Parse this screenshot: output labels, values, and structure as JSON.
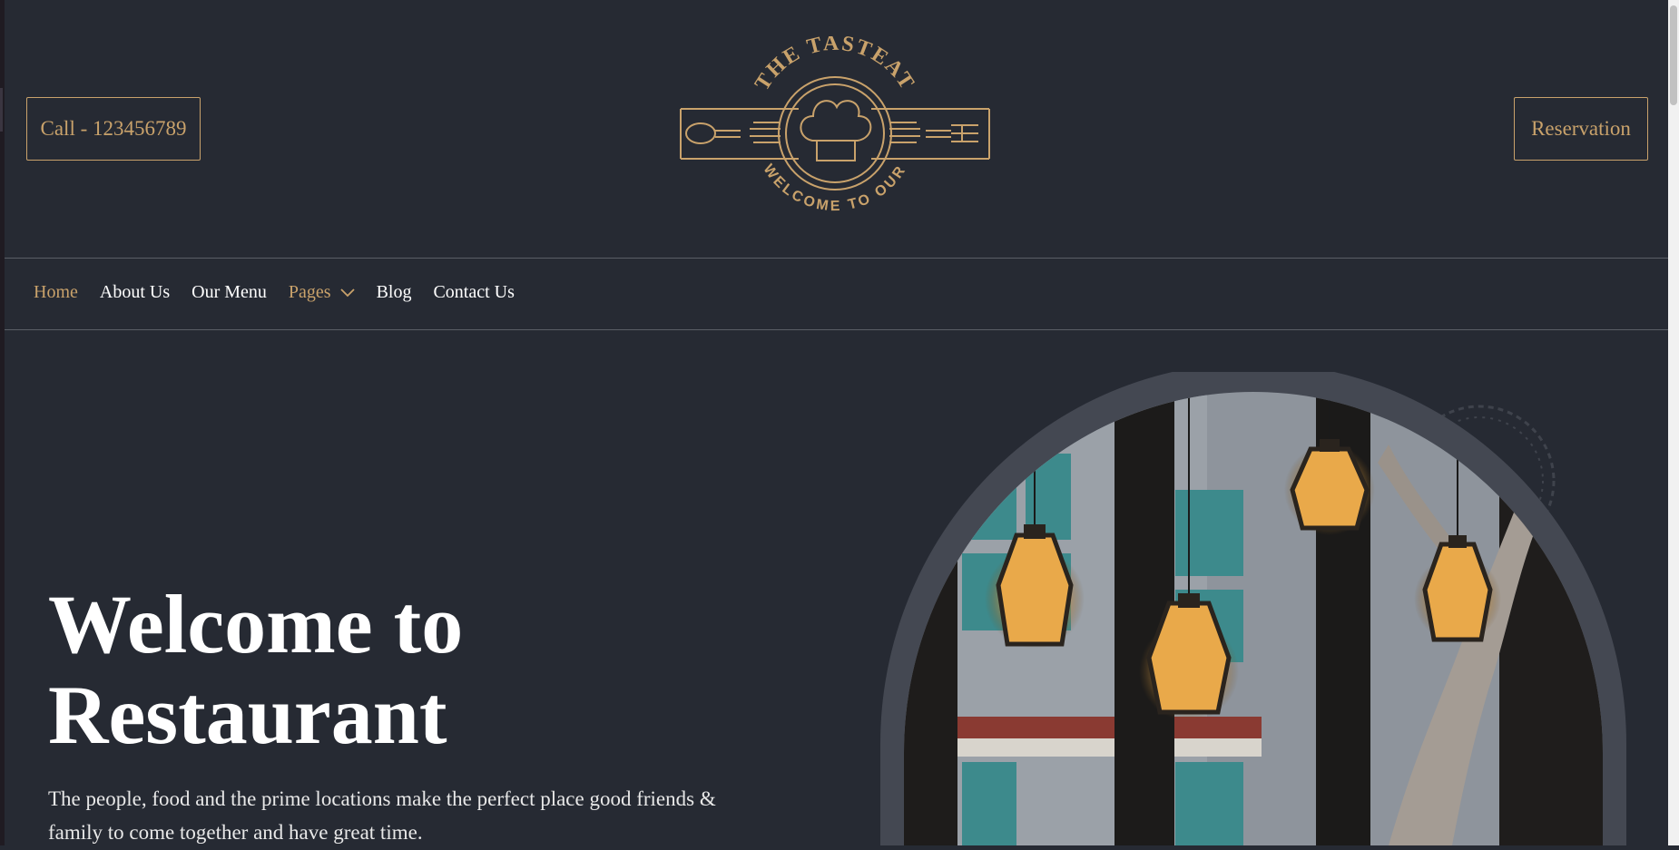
{
  "header": {
    "call_label": "Call - 123456789",
    "reservation_label": "Reservation",
    "logo": {
      "top_text": "THE TASTEAT",
      "bottom_text": "WELCOME TO OUR"
    }
  },
  "nav": {
    "items": [
      {
        "label": "Home"
      },
      {
        "label": "About Us"
      },
      {
        "label": "Our Menu"
      },
      {
        "label": "Pages"
      },
      {
        "label": "Blog"
      },
      {
        "label": "Contact Us"
      }
    ]
  },
  "hero": {
    "title_line1": "Welcome to",
    "title_line2": "Restaurant",
    "description": "The people, food and the prime locations make the perfect place good friends & family to come together and have great time."
  },
  "colors": {
    "background": "#262a33",
    "accent": "#c9a26b",
    "text": "#ffffff"
  },
  "icons": {
    "dropdown": "chevron-down-icon",
    "logo_spoon": "spoon-icon",
    "logo_fork": "fork-icon",
    "logo_chef_hat": "chef-hat-icon"
  }
}
